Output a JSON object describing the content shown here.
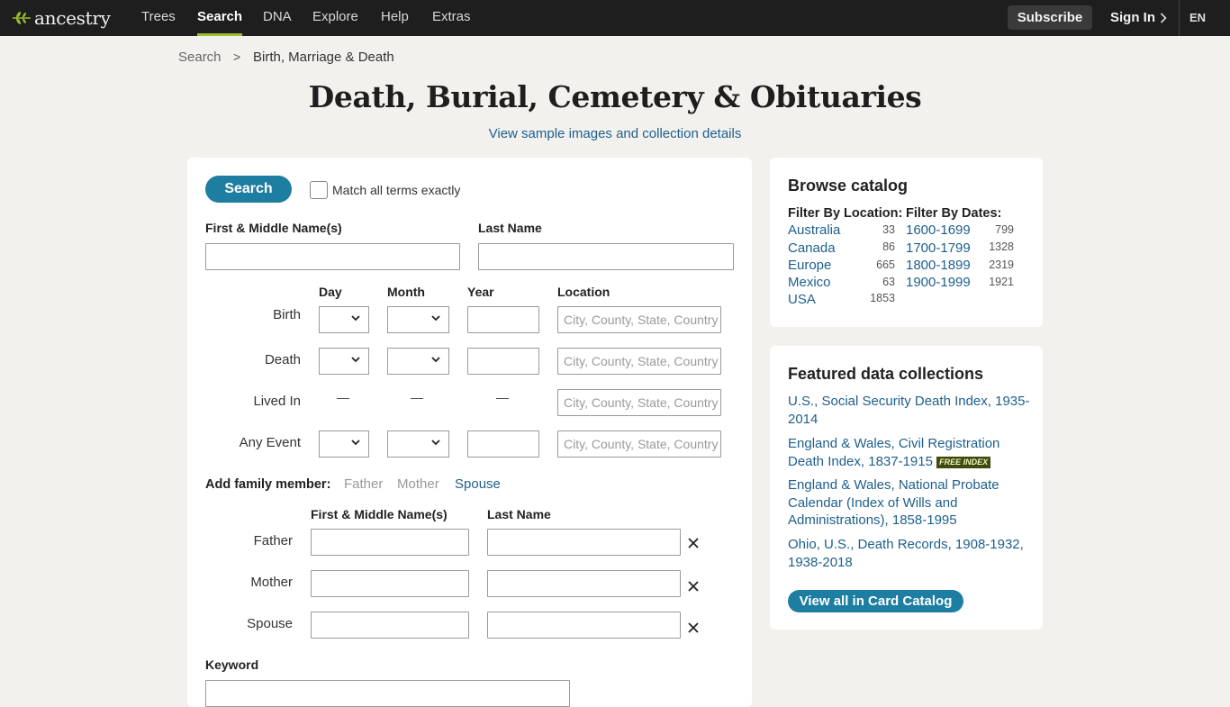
{
  "nav": {
    "logo": "ancestry",
    "items": [
      "Trees",
      "Search",
      "DNA",
      "Explore",
      "Help",
      "Extras"
    ],
    "subscribe": "Subscribe",
    "signin": "Sign In",
    "lang": "EN"
  },
  "breadcrumb": {
    "root": "Search",
    "sep": ">",
    "current": "Birth, Marriage & Death"
  },
  "title": "Death, Burial, Cemetery & Obituaries",
  "sample_link": "View sample images and collection details",
  "form": {
    "search_button": "Search",
    "exact_label": "Match all terms exactly",
    "first_name_label": "First & Middle Name(s)",
    "last_name_label": "Last Name",
    "col_day": "Day",
    "col_month": "Month",
    "col_year": "Year",
    "col_location": "Location",
    "rows": [
      "Birth",
      "Death",
      "Lived In",
      "Any Event"
    ],
    "location_placeholder": "City, County, State, Country",
    "dash": "—",
    "family_label": "Add family member:",
    "family_links": [
      "Father",
      "Mother",
      "Spouse"
    ],
    "family_first_label": "First & Middle Name(s)",
    "family_last_label": "Last Name",
    "family_rows": [
      "Father",
      "Mother",
      "Spouse"
    ],
    "keyword_label": "Keyword"
  },
  "browse": {
    "title": "Browse catalog",
    "location_header": "Filter By Location:",
    "dates_header": "Filter By Dates:",
    "locations": [
      {
        "name": "Australia",
        "count": "33"
      },
      {
        "name": "Canada",
        "count": "86"
      },
      {
        "name": "Europe",
        "count": "665"
      },
      {
        "name": "Mexico",
        "count": "63"
      },
      {
        "name": "USA",
        "count": "1853"
      }
    ],
    "dates": [
      {
        "name": "1600-1699",
        "count": "799"
      },
      {
        "name": "1700-1799",
        "count": "1328"
      },
      {
        "name": "1800-1899",
        "count": "2319"
      },
      {
        "name": "1900-1999",
        "count": "1921"
      }
    ]
  },
  "featured": {
    "title": "Featured data collections",
    "items": [
      "U.S., Social Security Death Index, 1935-2014",
      "England & Wales, Civil Registration Death Index, 1837-1915",
      "England & Wales, National Probate Calendar (Index of Wills and Administrations), 1858-1995",
      "Ohio, U.S., Death Records, 1908-1932, 1938-2018"
    ],
    "free_badge": "FREE INDEX",
    "catalog_button": "View all in Card Catalog"
  },
  "colors": {
    "nav_bg": "#1e1e1e",
    "accent_green": "#9cbe30",
    "button_blue": "#1d7ea1",
    "link_blue": "#1d5f8c"
  }
}
